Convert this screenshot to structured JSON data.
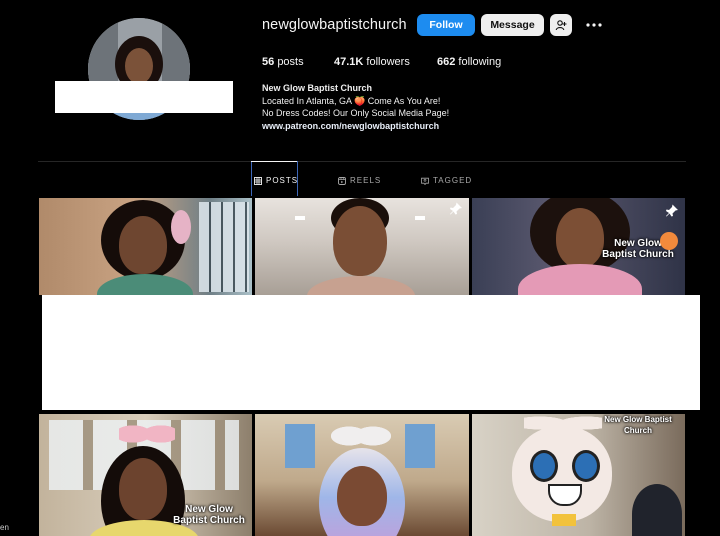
{
  "profile": {
    "username": "newglowbaptistchurch",
    "buttons": {
      "follow": "Follow",
      "message": "Message"
    },
    "stats": [
      {
        "value": "56",
        "label": "posts"
      },
      {
        "value": "47.1K",
        "label": "followers"
      },
      {
        "value": "662",
        "label": "following"
      }
    ],
    "bio": {
      "name": "New Glow Baptist Church",
      "line1": "Located In Atlanta, GA 🍑 Come As You Are!",
      "line2": "No Dress Codes! Our Only Social Media Page!",
      "link": "www.patreon.com/newglowbaptistchurch"
    }
  },
  "tabs": [
    {
      "label": "POSTS",
      "icon": "grid-icon",
      "active": true
    },
    {
      "label": "REELS",
      "icon": "reels-icon",
      "active": false
    },
    {
      "label": "TAGGED",
      "icon": "tagged-icon",
      "active": false
    }
  ],
  "posts": {
    "brand_text": "New Glow Baptist Church",
    "brand_text_short": "New Glow Baptist Church",
    "pinned_tiles": [
      2,
      3
    ]
  },
  "colors": {
    "follow_button": "#1d8cf0",
    "background": "#000000",
    "muted_text": "#a8a8a8"
  },
  "footer": {
    "lang": "en"
  }
}
